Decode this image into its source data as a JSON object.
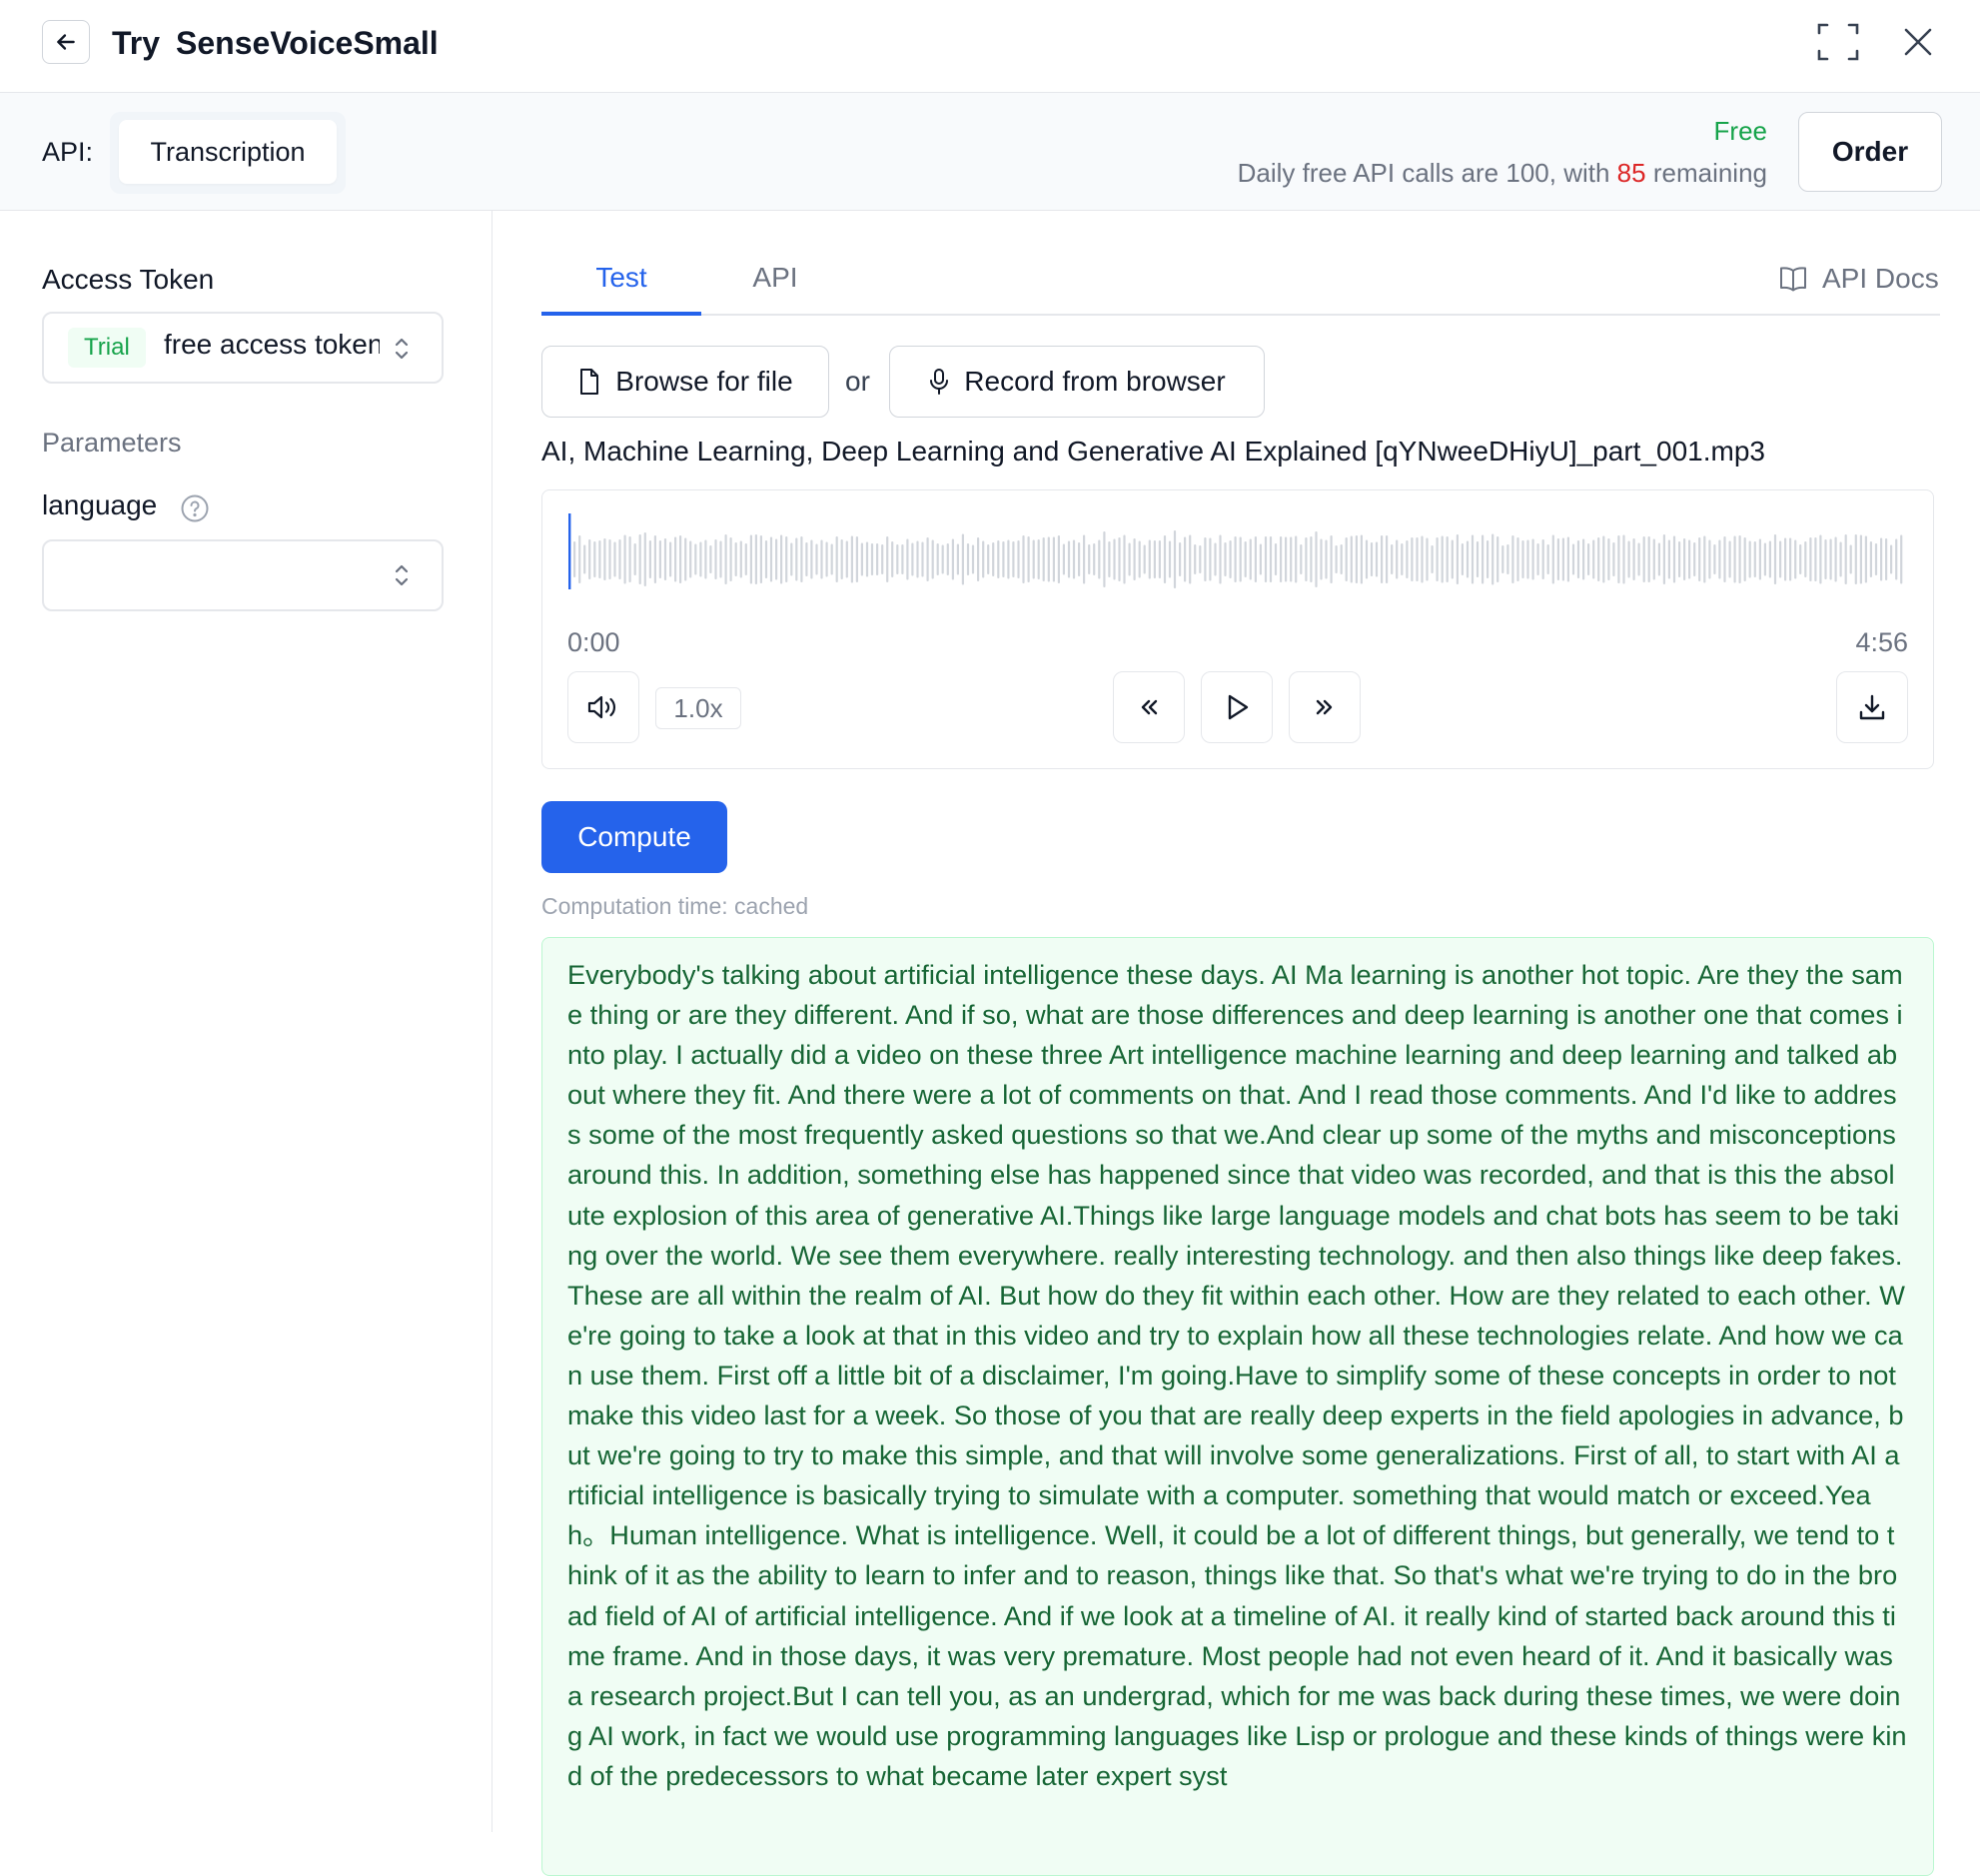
{
  "header": {
    "title_prefix": "Try",
    "model_name": "SenseVoiceSmall"
  },
  "api_bar": {
    "label": "API:",
    "selected_api": "Transcription",
    "plan": "Free",
    "daily_prefix": "Daily free API calls are 100, with",
    "remaining": "85",
    "daily_suffix": "remaining",
    "order_label": "Order"
  },
  "sidebar": {
    "access_token_label": "Access Token",
    "token_badge": "Trial",
    "token_value": "free access token",
    "parameters_label": "Parameters",
    "language_label": "language",
    "language_value": ""
  },
  "tabs": {
    "test": "Test",
    "api": "API",
    "docs": "API Docs",
    "active": "Test"
  },
  "upload": {
    "browse_label": "Browse for file",
    "or_label": "or",
    "record_label": "Record from browser",
    "filename": "AI, Machine Learning, Deep Learning and Generative AI Explained [qYNweeDHiyU]_part_001.mp3"
  },
  "player": {
    "time_current": "0:00",
    "time_total": "4:56",
    "speed": "1.0x",
    "progress": 0
  },
  "compute": {
    "button_label": "Compute",
    "computation_time": "Computation time: cached"
  },
  "output": {
    "text": "Everybody's talking about artificial intelligence these days. AI Ma learning is another hot topic. Are they the same thing or are they different. And if so, what are those differences and deep learning is another one that comes into play. I actually did a video on these three Art intelligence machine learning and deep learning and talked about where they fit. And there were a lot of comments on that. And I read those comments. And I'd like to address some of the most frequently asked questions so that we.And clear up some of the myths and misconceptions around this. In addition, something else has happened since that video was recorded, and that is this the absolute explosion of this area of generative AI.Things like large language models and chat bots has seem to be taking over the world. We see them everywhere. really interesting technology. and then also things like deep fakes. These are all within the realm of AI. But how do they fit within each other. How are they related to each other. We're going to take a look at that in this video and try to explain how all these technologies relate. And how we can use them. First off a little bit of a disclaimer, I'm going.Have to simplify some of these concepts in order to not make this video last for a week. So those of you that are really deep experts in the field apologies in advance, but we're going to try to make this simple, and that will involve some generalizations. First of all, to start with AI artificial intelligence is basically trying to simulate with a computer. something that would match or exceed.Yeah。Human intelligence. What is intelligence. Well, it could be a lot of different things, but generally, we tend to think of it as the ability to learn to infer and to reason, things like that. So that's what we're trying to do in the broad field of AI of artificial intelligence. And if we look at a timeline of AI. it really kind of started back around this time frame. And in those days, it was very premature. Most people had not even heard of it. And it basically was a research project.But I can tell you, as an undergrad, which for me was back during these times, we were doing AI work, in fact we would use programming languages like Lisp or prologue and these kinds of things were kind of the predecessors to what became later expert syst"
  },
  "colors": {
    "accent": "#2563eb",
    "free": "#16a34a",
    "remaining": "#dc2626",
    "output_bg": "#f0fdf4",
    "output_text": "#166534"
  }
}
